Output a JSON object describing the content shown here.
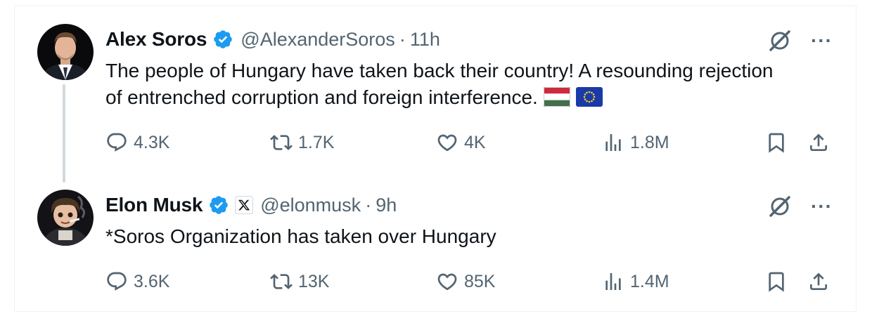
{
  "tweets": [
    {
      "name": "Alex Soros",
      "handle": "@AlexanderSoros",
      "separator": "·",
      "time": "11h",
      "text": "The people of Hungary have taken back their country! A resounding rejection of entrenched corruption and foreign interference.",
      "flags": [
        "hungary-flag",
        "eu-flag"
      ],
      "reply_count": "4.3K",
      "retweet_count": "1.7K",
      "like_count": "4K",
      "view_count": "1.8M"
    },
    {
      "name": "Elon Musk",
      "handle": "@elonmusk",
      "separator": "·",
      "time": "9h",
      "text": "*Soros Organization has taken over Hungary",
      "reply_count": "3.6K",
      "retweet_count": "13K",
      "like_count": "85K",
      "view_count": "1.4M"
    }
  ],
  "more_label": "···",
  "colors": {
    "text": "#0f1419",
    "secondary": "#536471",
    "verified": "#1d9bf0",
    "thread_line": "#cfd9de"
  },
  "icons": [
    "reply-icon",
    "retweet-icon",
    "like-icon",
    "views-icon",
    "bookmark-icon",
    "share-icon",
    "grok-icon",
    "more-icon",
    "verified-icon",
    "x-affiliate-icon"
  ]
}
